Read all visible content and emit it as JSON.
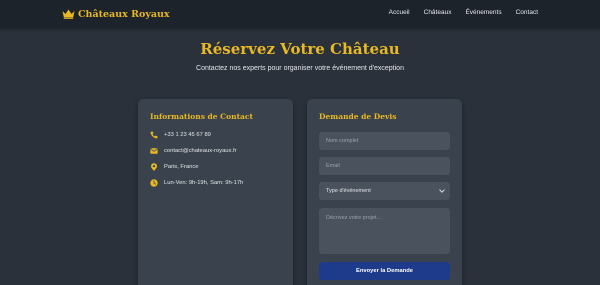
{
  "brand": {
    "name": "Châteaux Royaux",
    "icon": "crown-icon",
    "color": "#e8b923"
  },
  "nav": {
    "links": [
      "Accueil",
      "Châteaux",
      "Événements",
      "Contact"
    ]
  },
  "hero": {
    "title": "Réservez Votre Château",
    "subtitle": "Contactez nos experts pour organiser votre événement d'exception"
  },
  "contact": {
    "title": "Informations de Contact",
    "items": [
      {
        "icon": "phone-icon",
        "text": "+33 1 23 45 67 89"
      },
      {
        "icon": "envelope-icon",
        "text": "contact@chateaux-royaux.fr"
      },
      {
        "icon": "map-pin-icon",
        "text": "Paris, France"
      },
      {
        "icon": "clock-icon",
        "text": "Lun-Ven: 9h-19h, Sam: 9h-17h"
      }
    ]
  },
  "quote": {
    "title": "Demande de Devis",
    "name_placeholder": "Nom complet",
    "email_placeholder": "Email",
    "event_type_selected": "Type d'événement",
    "message_placeholder": "Décrivez votre projet...",
    "submit_label": "Envoyer la Demande"
  },
  "colors": {
    "accent": "#e8b923",
    "background": "#2a313b",
    "navbar": "#1d232b",
    "card": "#3a424d",
    "field": "#4a525e",
    "button": "#1e3a8a"
  }
}
